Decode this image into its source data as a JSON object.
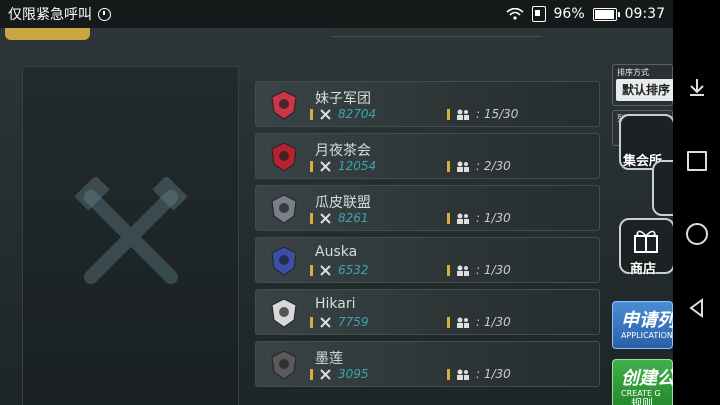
{
  "statusbar": {
    "left_text": "仅限紧急呼叫",
    "battery": "96%",
    "time": "09:37"
  },
  "clubs": [
    {
      "name": "妹子军团",
      "score": "82704",
      "members": "15/30",
      "emblem_color": "#c9354a"
    },
    {
      "name": "月夜茶会",
      "score": "12054",
      "members": "2/30",
      "emblem_color": "#b8212e"
    },
    {
      "name": "瓜皮联盟",
      "score": "8261",
      "members": "1/30",
      "emblem_color": "#7a7f8a"
    },
    {
      "name": "Auska",
      "score": "6532",
      "members": "1/30",
      "emblem_color": "#3b4fa6"
    },
    {
      "name": "Hikari",
      "score": "7759",
      "members": "1/30",
      "emblem_color": "#d8d8d8"
    },
    {
      "name": "墨莲",
      "score": "3095",
      "members": "1/30",
      "emblem_color": "#5a5a5a"
    }
  ],
  "sort": {
    "title": "排序方式",
    "value": "默认排序"
  },
  "filter": {
    "title": "列表筛选"
  },
  "side_buttons": {
    "gathering": "集会所",
    "shop": "商店"
  },
  "apply": {
    "label": "申请列",
    "sub": "APPLICATION"
  },
  "create": {
    "label": "创建公",
    "sub": "CREATE G"
  },
  "bottom_text": "规则",
  "colors": {
    "score": "#3aa5b0",
    "accent_bar": "#d6b03a",
    "apply": "#3a78c4",
    "create": "#34a03c"
  }
}
